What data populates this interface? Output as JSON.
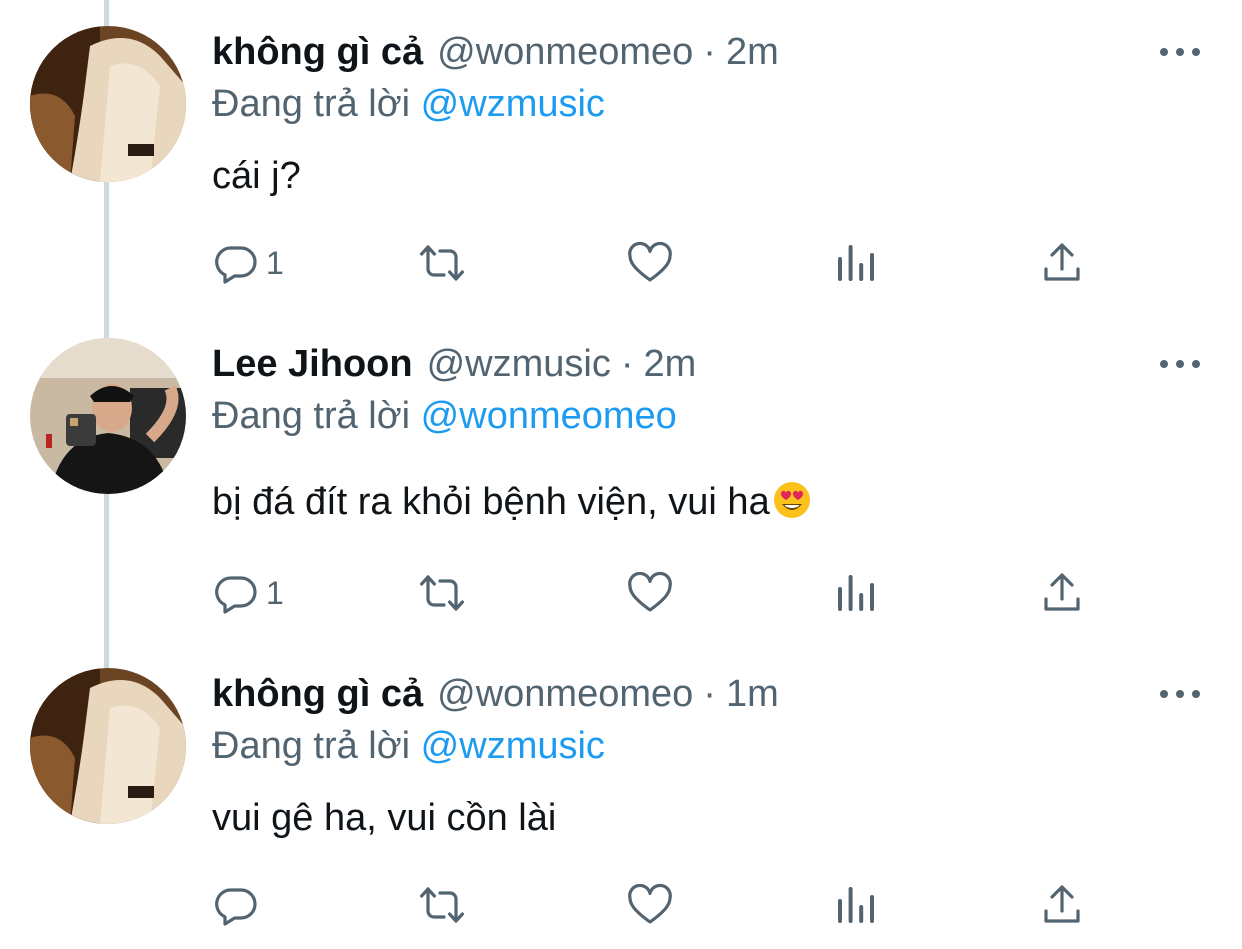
{
  "tweets": [
    {
      "name": "không gì cả",
      "handle": "@wonmeomeo",
      "dot": "·",
      "time": "2m",
      "replying_prefix": "Đang trả lời ",
      "replying_to": "@wzmusic",
      "text": "cái j?",
      "emoji": null,
      "reply_count": "1",
      "avatar": "avatar-white-shirt"
    },
    {
      "name": "Lee Jihoon",
      "handle": "@wzmusic",
      "dot": "·",
      "time": "2m",
      "replying_prefix": "Đang trả lời ",
      "replying_to": "@wonmeomeo",
      "text": "bị đá đít ra khỏi bệnh viện, vui ha",
      "emoji": "heart-eyes-emoji",
      "reply_count": "1",
      "avatar": "avatar-mirror-selfie"
    },
    {
      "name": "không gì cả",
      "handle": "@wonmeomeo",
      "dot": "·",
      "time": "1m",
      "replying_prefix": "Đang trả lời ",
      "replying_to": "@wzmusic",
      "text": "vui gê ha, vui cồn lài",
      "emoji": null,
      "reply_count": "",
      "avatar": "avatar-white-shirt"
    }
  ],
  "colors": {
    "name": "#0f1419",
    "muted": "#536471",
    "mention": "#1d9bf0",
    "thread_line": "#cfd9de"
  },
  "icons": [
    "reply-icon",
    "retweet-icon",
    "like-icon",
    "analytics-icon",
    "share-icon",
    "more-icon"
  ]
}
